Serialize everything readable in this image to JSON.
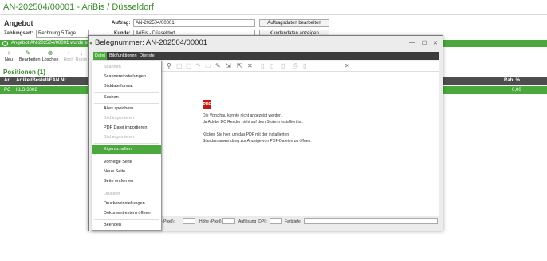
{
  "app": {
    "title": "AN-202504/00001 - AriBis / Düsseldorf",
    "section_title": "Angebot",
    "payment_label": "Zahlungsart:",
    "payment_value": "Rechnung 5 Tage",
    "order_label": "Auftrag:",
    "order_value": "AN-202504/00001",
    "customer_label": "Kunde:",
    "customer_value": "AriBis - Düsseldorf",
    "order_data_button": "Auftragsdaten bearbeiten",
    "customer_data_button": "Kundendaten anzeigen",
    "notice": "Angebot AN-202504/00001 wurde erfo",
    "toolbar": [
      {
        "label": "Neu",
        "icon": "plus-icon",
        "glyph": "+",
        "disabled": false
      },
      {
        "label": "Bearbeiten",
        "icon": "edit-icon",
        "glyph": "✎",
        "disabled": false
      },
      {
        "label": "Löschen",
        "icon": "delete-icon",
        "glyph": "⊗",
        "disabled": false
      },
      {
        "label": "Hoch",
        "icon": "up-icon",
        "glyph": "↑",
        "disabled": true
      },
      {
        "label": "Runte",
        "icon": "down-icon",
        "glyph": "↓",
        "disabled": true
      }
    ],
    "positions_title": "Positionen (1)",
    "table": {
      "headers": [
        "Ar",
        "Artikel/Bestell/EAN Nr.",
        "Rab. %"
      ],
      "row": [
        "PC",
        "KLS-3002",
        "0,00"
      ]
    }
  },
  "modal": {
    "title": "Belegnummer: AN-202504/00001",
    "menu": [
      "Datei",
      "Bildfunktionen",
      "Dienste"
    ],
    "active_menu": "Datei",
    "preview_lines": [
      "Die Vorschau konnte nicht angezeigt werden,",
      "da Adobe DC Reader nicht auf dem System installiert ist.",
      "Klicken Sie hier, um das PDF mit der installierten",
      "Standardanwendung zur Anzeige von PDF-Dateien zu öffnen."
    ],
    "pdf_icon_label": "PDF",
    "status": {
      "width_label": "Breite (Pixel):",
      "height_label": "Höhe (Pixel):",
      "resolution_label": "Auflösung (DPI):",
      "color_depth_label": "Farbtiefe:"
    }
  },
  "dropdown": [
    {
      "label": "Scannen",
      "disabled": true
    },
    {
      "label": "Scannereinstellungen",
      "disabled": false
    },
    {
      "label": "Bilddateiformat",
      "disabled": false
    },
    {
      "sep": true
    },
    {
      "label": "Suchen",
      "disabled": false
    },
    {
      "sep": true
    },
    {
      "label": "Alles speichern",
      "disabled": false
    },
    {
      "label": "Bild importieren",
      "disabled": true
    },
    {
      "label": "PDF Datei importieren",
      "disabled": false
    },
    {
      "label": "Bild exportieren",
      "disabled": true
    },
    {
      "sep": true
    },
    {
      "label": "Eigenschaften",
      "disabled": false,
      "highlight": true
    },
    {
      "sep": true
    },
    {
      "label": "Vorheige Seite",
      "disabled": false
    },
    {
      "label": "Neue Seite",
      "disabled": false
    },
    {
      "label": "Seite entfernen",
      "disabled": false
    },
    {
      "sep": true
    },
    {
      "label": "Drucken",
      "disabled": true
    },
    {
      "label": "Druckereinstellungen",
      "disabled": false
    },
    {
      "label": "Dokument extern öffnen",
      "disabled": false
    },
    {
      "sep": true
    },
    {
      "label": "Beenden",
      "disabled": false
    }
  ],
  "colors": {
    "accent": "#4aa83c",
    "header_dark": "#4d4d4d",
    "menubar": "#3c3c3c"
  }
}
